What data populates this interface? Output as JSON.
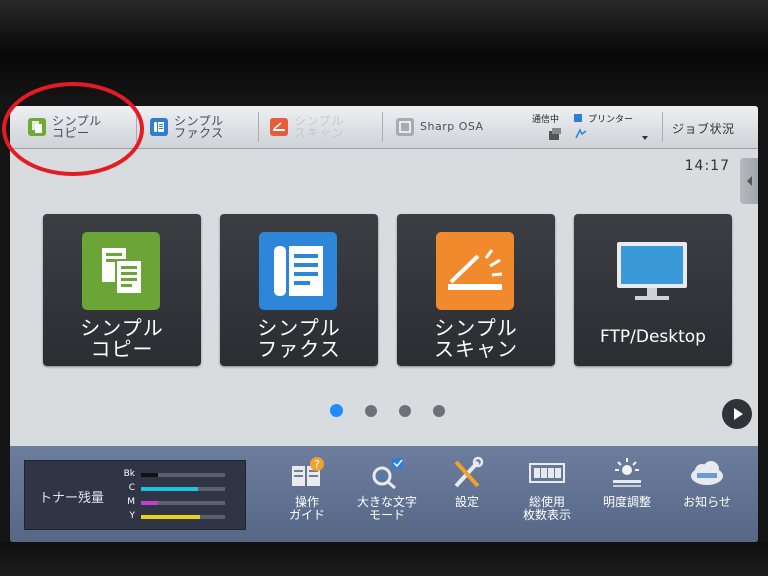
{
  "topbar": {
    "items": [
      {
        "label": "シンプル\nコピー",
        "icon": "copy-icon",
        "color": "#6ea93a"
      },
      {
        "label": "シンプル\nファクス",
        "icon": "fax-icon",
        "color": "#2e7fd0"
      },
      {
        "label": "シンプル\nスキャン",
        "icon": "scan-icon",
        "color": "#e85c3a"
      },
      {
        "label": "Sharp OSA",
        "icon": "osa-icon",
        "color": "#a7acb3"
      }
    ],
    "status": {
      "communicating": "通信中",
      "printer": "プリンター"
    },
    "job_status": "ジョブ状況"
  },
  "clock": "14:17",
  "tiles": [
    {
      "label": "シンプル\nコピー",
      "icon": "copy-icon",
      "color": "#6aa535"
    },
    {
      "label": "シンプル\nファクス",
      "icon": "fax-icon",
      "color": "#2e86d8"
    },
    {
      "label": "シンプル\nスキャン",
      "icon": "scan-icon",
      "color": "#f08a2c"
    },
    {
      "label": "FTP/Desktop",
      "icon": "monitor-icon",
      "color": "#3a9ad9"
    }
  ],
  "pager": {
    "current": 1,
    "total": 4
  },
  "toner": {
    "title": "トナー残量",
    "levels": [
      {
        "name": "Bk",
        "level": 0.2,
        "color": "#111111"
      },
      {
        "name": "C",
        "level": 0.68,
        "color": "#1fc3e0"
      },
      {
        "name": "M",
        "level": 0.2,
        "color": "#c040c8"
      },
      {
        "name": "Y",
        "level": 0.7,
        "color": "#e8d21c"
      }
    ]
  },
  "tools": [
    {
      "label": "操作\nガイド",
      "icon": "guide-icon"
    },
    {
      "label": "大きな文字\nモード",
      "icon": "large-text-icon"
    },
    {
      "label": "設定",
      "icon": "settings-tools-icon"
    },
    {
      "label": "総使用\n枚数表示",
      "icon": "counter-icon"
    },
    {
      "label": "明度調整",
      "icon": "brightness-icon"
    },
    {
      "label": "お知らせ",
      "icon": "cloud-info-icon"
    }
  ]
}
